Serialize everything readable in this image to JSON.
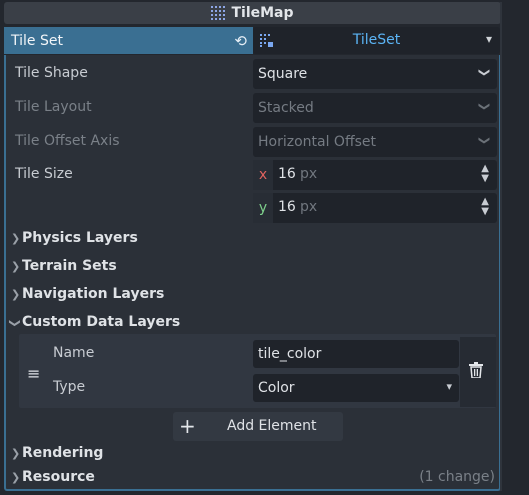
{
  "header": {
    "title": "TileMap",
    "icon": "tilemap-grid-icon"
  },
  "tile_set": {
    "label": "Tile Set",
    "revert_icon": "revert-icon",
    "value": "TileSet",
    "value_icon": "tileset-icon",
    "dropdown_icon": "chevron-down-icon"
  },
  "properties": {
    "tile_shape": {
      "label": "Tile Shape",
      "value": "Square"
    },
    "tile_layout": {
      "label": "Tile Layout",
      "value": "Stacked"
    },
    "tile_offset_axis": {
      "label": "Tile Offset Axis",
      "value": "Horizontal Offset"
    },
    "tile_size": {
      "label": "Tile Size",
      "x_axis": "x",
      "x_value": "16",
      "x_unit": "px",
      "y_axis": "y",
      "y_value": "16",
      "y_unit": "px"
    }
  },
  "sections": {
    "physics_layers": "Physics Layers",
    "terrain_sets": "Terrain Sets",
    "navigation_layers": "Navigation Layers",
    "custom_data_layers": "Custom Data Layers",
    "rendering": "Rendering",
    "resource": "Resource",
    "resource_changes": "(1 change)"
  },
  "custom_data_element": {
    "name_label": "Name",
    "name_value": "tile_color",
    "type_label": "Type",
    "type_value": "Color"
  },
  "add_element": {
    "label": "Add Element"
  },
  "colors": {
    "accent": "#3a6f92",
    "link_blue": "#5bb4f5",
    "axis_x": "#e0635f",
    "axis_y": "#7ed08c"
  }
}
